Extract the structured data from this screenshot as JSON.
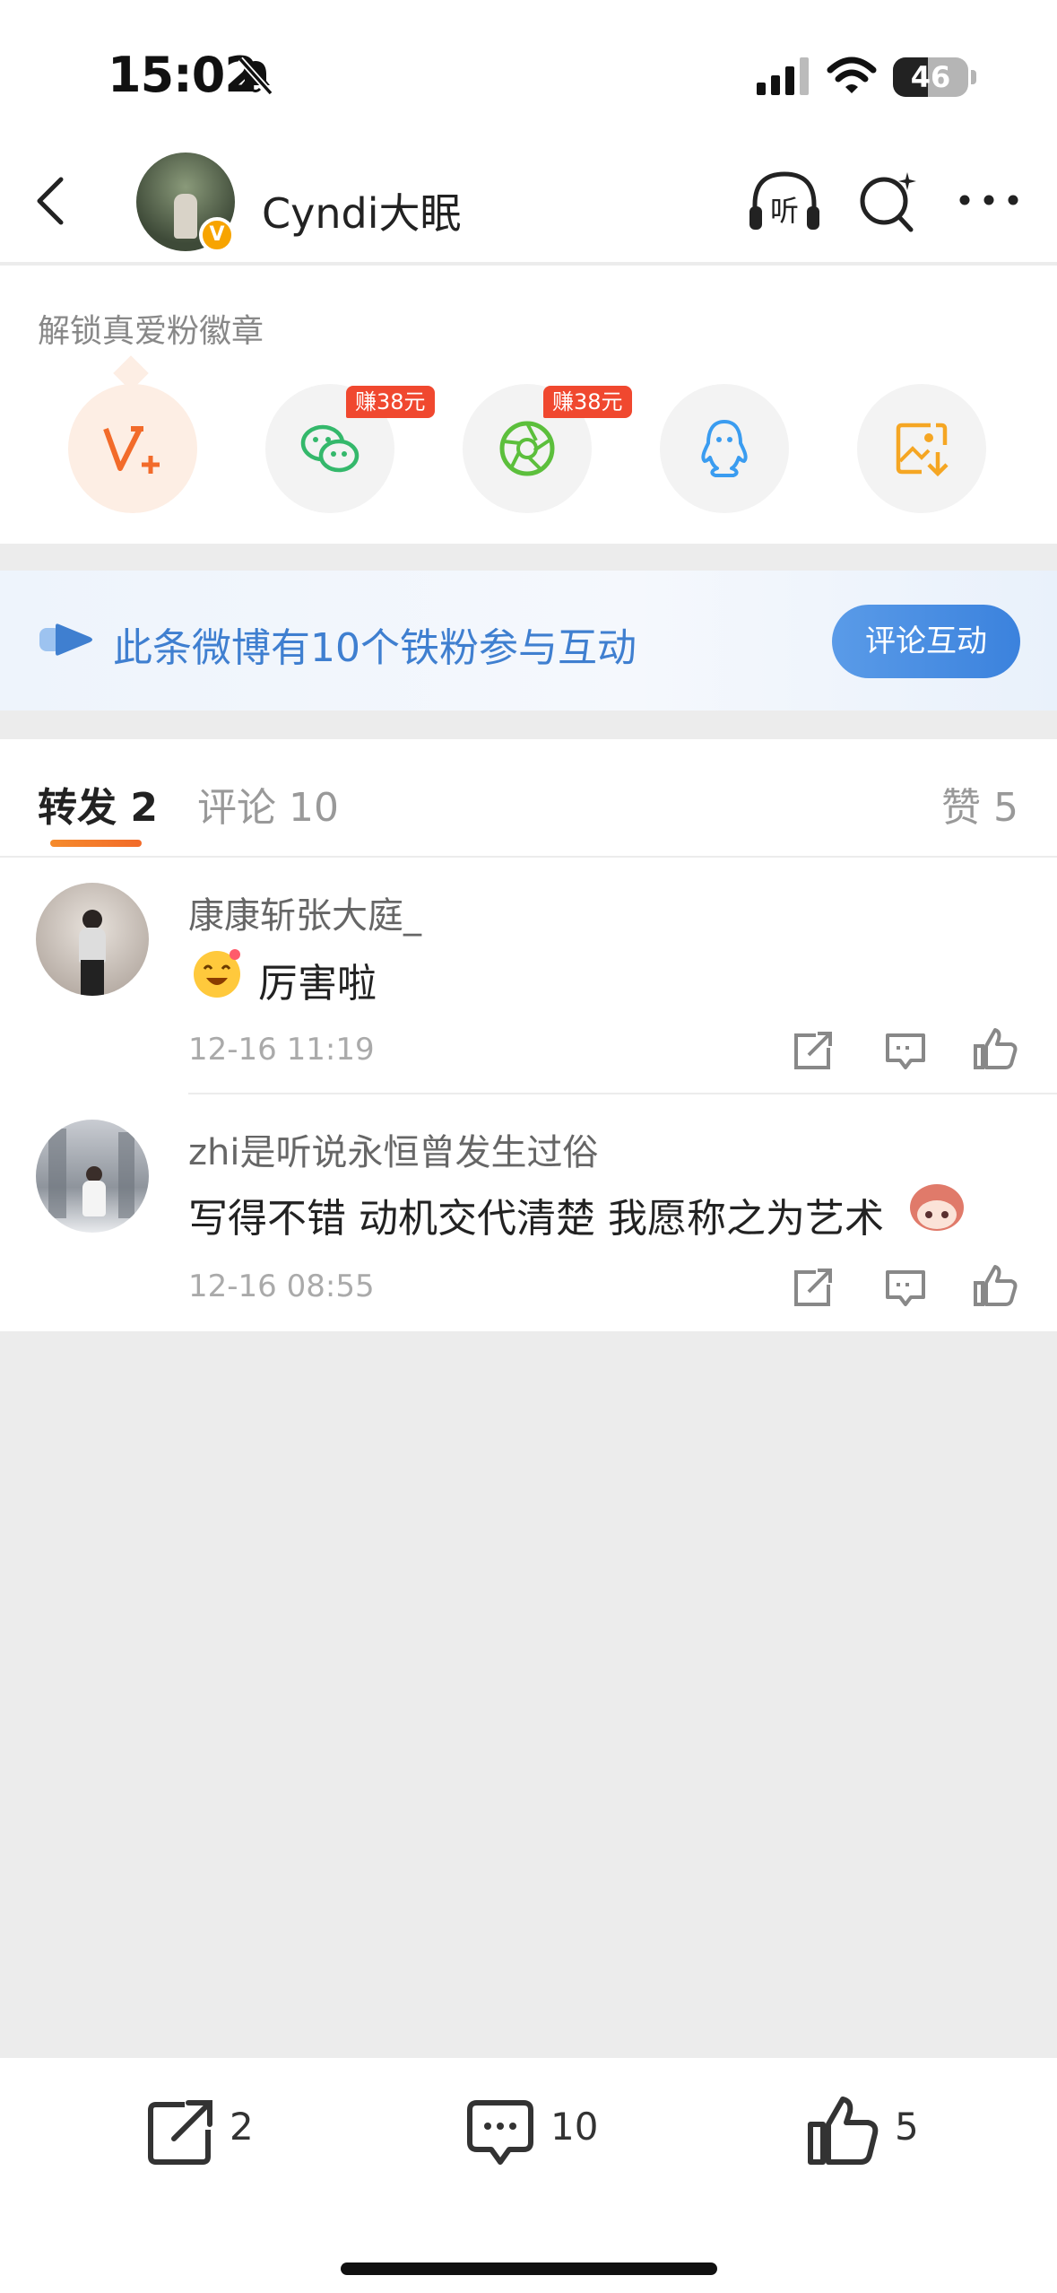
{
  "status_bar": {
    "time": "15:02",
    "battery": "46",
    "battery_level": 0.46
  },
  "header": {
    "username": "Cyndi大眠",
    "verified_badge": "V",
    "icons": [
      "back-icon",
      "listen-icon",
      "search-icon",
      "more-icon"
    ]
  },
  "share_panel": {
    "title": "解锁真爱粉徽章",
    "buttons": [
      {
        "name": "weibo-vplus",
        "badge": ""
      },
      {
        "name": "wechat",
        "badge": "赚38元"
      },
      {
        "name": "moments",
        "badge": "赚38元"
      },
      {
        "name": "qq",
        "badge": ""
      },
      {
        "name": "save-image",
        "badge": ""
      }
    ]
  },
  "banner": {
    "text": "此条微博有10个铁粉参与互动",
    "button": "评论互动"
  },
  "tabs": [
    {
      "label": "转发 2"
    },
    {
      "label": "评论 10"
    },
    {
      "label": "赞 5"
    }
  ],
  "comments": [
    {
      "user": "康康斩张大庭_",
      "text": "厉害啦",
      "time": "12-16 11:19"
    },
    {
      "user": "zhi是听说永恒曾发生过俗",
      "text": "写得不错 动机交代清楚 我愿称之为艺术",
      "time": "12-16 08:55"
    }
  ],
  "bottom_bar": {
    "repost_count": "2",
    "comment_count": "10",
    "like_count": "5"
  },
  "colors": {
    "accent_orange": "#f26b2a",
    "banner_blue": "#3f7fd0",
    "earn_red": "#f0482f"
  }
}
